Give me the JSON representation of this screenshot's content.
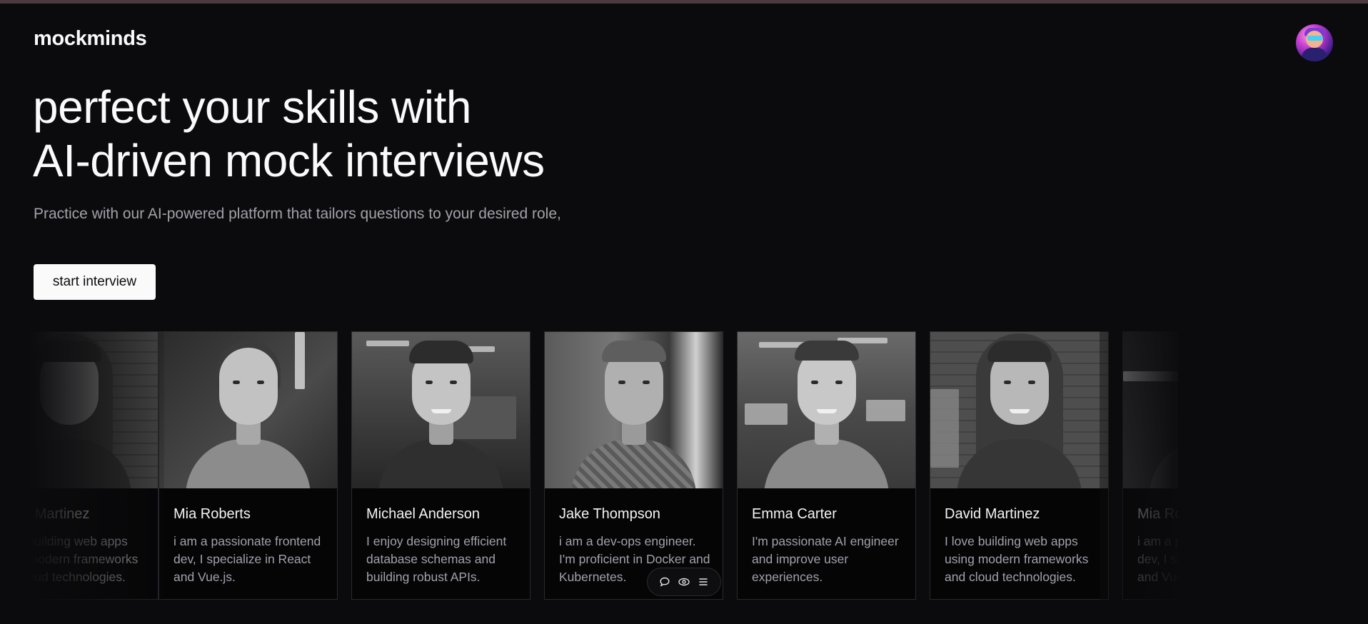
{
  "brand": "mockminds",
  "hero": {
    "headline_line1": "perfect your skills with",
    "headline_line2": "AI-driven mock interviews",
    "subtext": "Practice with our AI-powered platform that tailors questions to your desired role,",
    "cta_label": "start interview"
  },
  "interviewers": [
    {
      "name": "David Martinez",
      "bio": "I love building web apps using modern frameworks and cloud technologies."
    },
    {
      "name": "Mia Roberts",
      "bio": "i am a passionate frontend dev, I specialize in React and Vue.js."
    },
    {
      "name": "Michael Anderson",
      "bio": "I enjoy designing efficient database schemas and building robust APIs."
    },
    {
      "name": "Jake Thompson",
      "bio": "i am a dev-ops engineer. I'm proficient in Docker and Kubernetes."
    },
    {
      "name": "Emma Carter",
      "bio": "I'm passionate AI engineer and improve user experiences."
    },
    {
      "name": "David Martinez",
      "bio": "I love building web apps using modern frameworks and cloud technologies."
    },
    {
      "name": "Mia Roberts",
      "bio": "i am a passionate frontend dev, I specialize in React and Vue.js."
    }
  ],
  "toolbar": {
    "icons": [
      "chat-bubble-icon",
      "eye-icon",
      "menu-icon"
    ]
  },
  "colors": {
    "background": "#0b0b0d",
    "top_strip": "#4a3a40",
    "button_bg": "#fafafa",
    "muted_text": "#a1a1aa",
    "card_border": "#2a2a2e"
  }
}
